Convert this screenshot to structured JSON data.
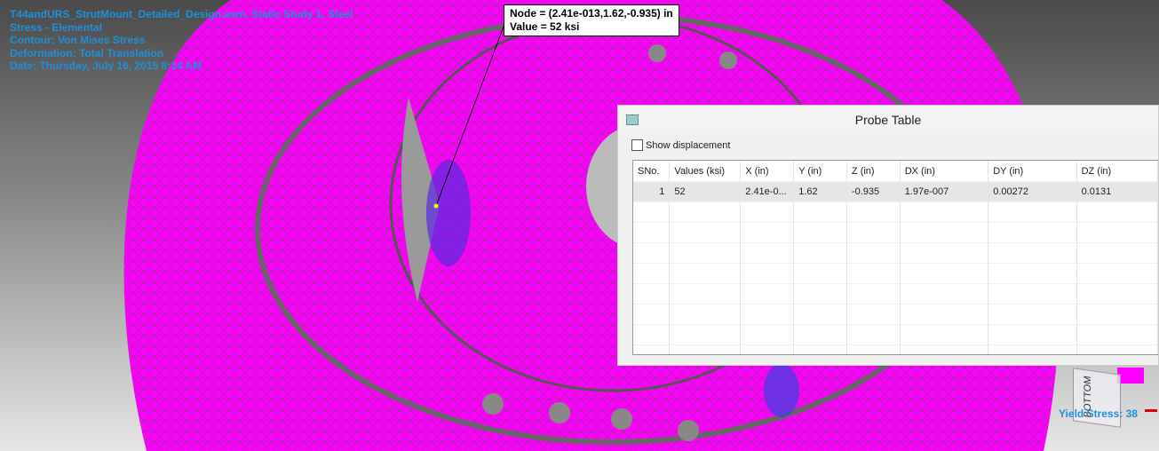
{
  "info": {
    "lines": [
      "T44andURS_StrutMount_Detailed_Design.asm, Static Study 1, Steel",
      "Stress - Elemental",
      "Contour: Von Mises Stress",
      "Deformation: Total Translation",
      "Date: Thursday, July 16, 2015 8:14 AM"
    ]
  },
  "tooltip": {
    "node": "Node = (2.41e-013,1.62,-0.935) in",
    "value": "Value = 52 ksi"
  },
  "probe_table": {
    "title": "Probe Table",
    "show_displacement_label": "Show displacement",
    "show_displacement_checked": false,
    "columns": [
      "SNo.",
      "Values (ksi)",
      "X (in)",
      "Y (in)",
      "Z (in)",
      "DX (in)",
      "DY (in)",
      "DZ (in)"
    ],
    "rows": [
      [
        "1",
        "52",
        "2.41e-0...",
        "1.62",
        "-0.935",
        "1.97e-007",
        "0.00272",
        "0.0131"
      ]
    ]
  },
  "legend": {
    "yield_stress": "Yield Stress: 38"
  },
  "view_cube": {
    "face_label": "BOTTOM"
  },
  "colors": {
    "mesh": "#ff00ff",
    "text_accent": "#1e8fd8",
    "high_stress": "#7a20e0"
  }
}
